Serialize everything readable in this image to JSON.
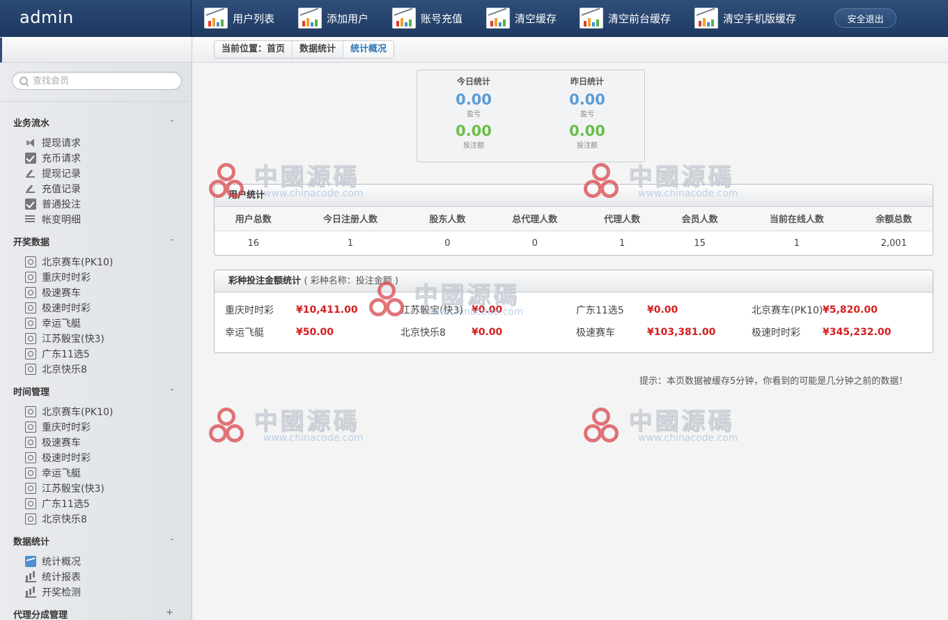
{
  "header": {
    "brand": "admin",
    "nav": [
      {
        "label": "用户列表",
        "icon": "chart-report-icon"
      },
      {
        "label": "添加用户",
        "icon": "chart-report-icon"
      },
      {
        "label": "账号充值",
        "icon": "chart-report-icon"
      },
      {
        "label": "清空缓存",
        "icon": "chart-report-icon"
      },
      {
        "label": "清空前台缓存",
        "icon": "chart-report-icon"
      },
      {
        "label": "清空手机版缓存",
        "icon": "chart-report-icon"
      }
    ],
    "logout_label": "安全退出"
  },
  "sidebar": {
    "search_placeholder": "查找会员",
    "groups": [
      {
        "title": "业务流水",
        "toggle": "-",
        "items": [
          {
            "label": "提现请求",
            "icon": "speaker-icon"
          },
          {
            "label": "充币请求",
            "icon": "check-icon"
          },
          {
            "label": "提现记录",
            "icon": "pen-icon"
          },
          {
            "label": "充值记录",
            "icon": "pen-icon"
          },
          {
            "label": "普通投注",
            "icon": "check-icon"
          },
          {
            "label": "帐变明细",
            "icon": "list-icon"
          }
        ]
      },
      {
        "title": "开奖数据",
        "toggle": "-",
        "items": [
          {
            "label": "北京赛车(PK10)",
            "icon": "target-icon"
          },
          {
            "label": "重庆时时彩",
            "icon": "target-icon"
          },
          {
            "label": "极速赛车",
            "icon": "target-icon"
          },
          {
            "label": "极速时时彩",
            "icon": "target-icon"
          },
          {
            "label": "幸运飞艇",
            "icon": "target-icon"
          },
          {
            "label": "江苏骰宝(快3)",
            "icon": "target-icon"
          },
          {
            "label": "广东11选5",
            "icon": "target-icon"
          },
          {
            "label": "北京快乐8",
            "icon": "target-icon"
          }
        ]
      },
      {
        "title": "时间管理",
        "toggle": "-",
        "items": [
          {
            "label": "北京赛车(PK10)",
            "icon": "target-icon"
          },
          {
            "label": "重庆时时彩",
            "icon": "target-icon"
          },
          {
            "label": "极速赛车",
            "icon": "target-icon"
          },
          {
            "label": "极速时时彩",
            "icon": "target-icon"
          },
          {
            "label": "幸运飞艇",
            "icon": "target-icon"
          },
          {
            "label": "江苏骰宝(快3)",
            "icon": "target-icon"
          },
          {
            "label": "广东11选5",
            "icon": "target-icon"
          },
          {
            "label": "北京快乐8",
            "icon": "target-icon"
          }
        ]
      },
      {
        "title": "数据统计",
        "toggle": "-",
        "items": [
          {
            "label": "统计概况",
            "icon": "line-chart-icon"
          },
          {
            "label": "统计报表",
            "icon": "bar-chart-icon"
          },
          {
            "label": "开奖检测",
            "icon": "bar-chart-icon"
          }
        ]
      },
      {
        "title": "代理分成管理",
        "toggle": "+",
        "items": []
      }
    ]
  },
  "breadcrumb": [
    "当前位置：首页",
    "数据统计",
    "统计概况"
  ],
  "today_card": {
    "today": {
      "title": "今日统计",
      "profit": "0.00",
      "profit_label": "盈亏",
      "bets": "0.00",
      "bets_label": "投注额"
    },
    "yesterday": {
      "title": "昨日统计",
      "profit": "0.00",
      "profit_label": "盈亏",
      "bets": "0.00",
      "bets_label": "投注额"
    }
  },
  "user_stats": {
    "title": "用户统计",
    "columns": [
      "用户总数",
      "今日注册人数",
      "股东人数",
      "总代理人数",
      "代理人数",
      "会员人数",
      "当前在线人数",
      "余额总数"
    ],
    "values": [
      "16",
      "1",
      "0",
      "0",
      "1",
      "15",
      "1",
      "2,001"
    ]
  },
  "bet_stats": {
    "title": "彩种投注金额统计",
    "subtitle": "( 彩种名称：投注金额 )",
    "items": [
      {
        "name": "重庆时时彩",
        "amount": "¥10,411.00"
      },
      {
        "name": "江苏骰宝(快3)",
        "amount": "¥0.00"
      },
      {
        "name": "广东11选5",
        "amount": "¥0.00"
      },
      {
        "name": "北京赛车(PK10)",
        "amount": "¥5,820.00"
      },
      {
        "name": "幸运飞艇",
        "amount": "¥50.00"
      },
      {
        "name": "北京快乐8",
        "amount": "¥0.00"
      },
      {
        "name": "极速赛车",
        "amount": "¥103,381.00"
      },
      {
        "name": "极速时时彩",
        "amount": "¥345,232.00"
      }
    ]
  },
  "hint": "提示：本页数据被缓存5分钟，你看到的可能是几分钟之前的数据！",
  "watermark": {
    "cn": "中國源碼",
    "url": "www.chinacode.com"
  },
  "colors": {
    "topbar": "#1f3b63",
    "profit_blue": "#5b9bd9",
    "bet_green": "#6bbe4a",
    "amount_red": "#d42020",
    "active_crumb": "#2d75b8"
  }
}
